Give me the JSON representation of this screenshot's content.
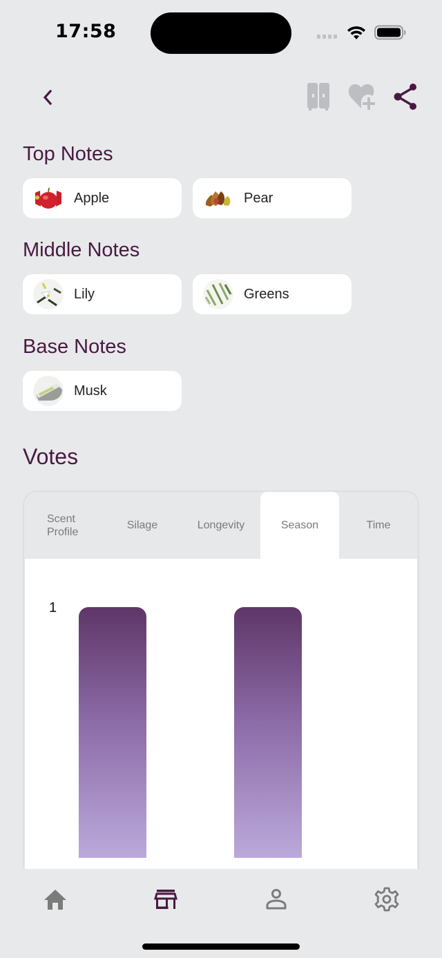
{
  "status_bar": {
    "time": "17:58"
  },
  "toolbar": {
    "back_icon": "chevron-left-icon",
    "compare_icon": "wardrobe-icon",
    "wishlist_icon": "heart-plus-icon",
    "share_icon": "share-icon"
  },
  "notes": {
    "top": {
      "title": "Top Notes",
      "items": [
        {
          "label": "Apple",
          "icon": "apple-image"
        },
        {
          "label": "Pear",
          "icon": "pear-image"
        }
      ]
    },
    "middle": {
      "title": "Middle Notes",
      "items": [
        {
          "label": "Lily",
          "icon": "lily-image"
        },
        {
          "label": "Greens",
          "icon": "greens-image"
        }
      ]
    },
    "base": {
      "title": "Base Notes",
      "items": [
        {
          "label": "Musk",
          "icon": "musk-image"
        }
      ]
    }
  },
  "votes": {
    "title": "Votes",
    "tabs": [
      {
        "label": "Scent Profile",
        "active": false
      },
      {
        "label": "Silage",
        "active": false
      },
      {
        "label": "Longevity",
        "active": false
      },
      {
        "label": "Season",
        "active": true
      },
      {
        "label": "Time",
        "active": false
      }
    ]
  },
  "chart_data": {
    "type": "bar",
    "title": "",
    "xlabel": "",
    "ylabel": "",
    "y_tick_labels": [
      "1"
    ],
    "ylim": [
      0,
      1
    ],
    "categories": [
      "",
      ""
    ],
    "values": [
      1,
      1
    ],
    "grid": false,
    "colors": {
      "top": "#5e3668",
      "bottom": "#bba9db"
    }
  },
  "bottom_nav": {
    "items": [
      {
        "name": "home",
        "icon": "home-icon",
        "active": false
      },
      {
        "name": "store",
        "icon": "store-icon",
        "active": true
      },
      {
        "name": "profile",
        "icon": "person-icon",
        "active": false
      },
      {
        "name": "settings",
        "icon": "gear-icon",
        "active": false
      }
    ]
  },
  "colors": {
    "accent": "#4a1942",
    "inactive_icon": "#bdbec1",
    "nav_inactive": "#7b7b7b",
    "background": "#e8e9eb"
  }
}
